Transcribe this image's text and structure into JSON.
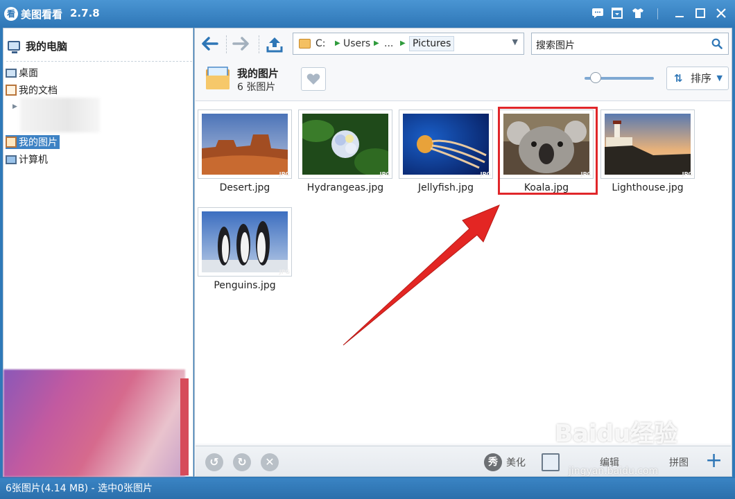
{
  "app": {
    "logo_char": "看",
    "title": "美图看看",
    "version": "2.7.8"
  },
  "left": {
    "root_label": "我的电脑",
    "items": [
      {
        "label": "桌面",
        "icon": "desktop-icon"
      },
      {
        "label": "我的文档",
        "icon": "documents-icon"
      },
      {
        "label": "我的图片",
        "icon": "pictures-folder-icon",
        "selected": true
      },
      {
        "label": "计算机",
        "icon": "computer-icon"
      }
    ]
  },
  "address": {
    "crumbs": [
      "C:",
      "Users",
      "...",
      "Pictures"
    ]
  },
  "search": {
    "value": "搜索图片"
  },
  "folder": {
    "title": "我的图片",
    "count": "6 张图片"
  },
  "sort": {
    "label": "排序"
  },
  "thumbnails": [
    {
      "name": "Desert.jpg"
    },
    {
      "name": "Hydrangeas.jpg"
    },
    {
      "name": "Jellyfish.jpg"
    },
    {
      "name": "Koala.jpg",
      "highlighted": true
    },
    {
      "name": "Lighthouse.jpg"
    },
    {
      "name": "Penguins.jpg"
    }
  ],
  "badge_text": "JPG",
  "toolbar": {
    "beautify_label": "美化",
    "edit_label": "编辑",
    "puzzle_label": "拼图"
  },
  "status": "6张图片(4.14 MB) - 选中0张图片",
  "watermark": {
    "brand": "Baidu经验",
    "url": "jingyan.baidu.com"
  },
  "colors": {
    "accent": "#2e76b6",
    "highlight_red": "#e0262a"
  }
}
